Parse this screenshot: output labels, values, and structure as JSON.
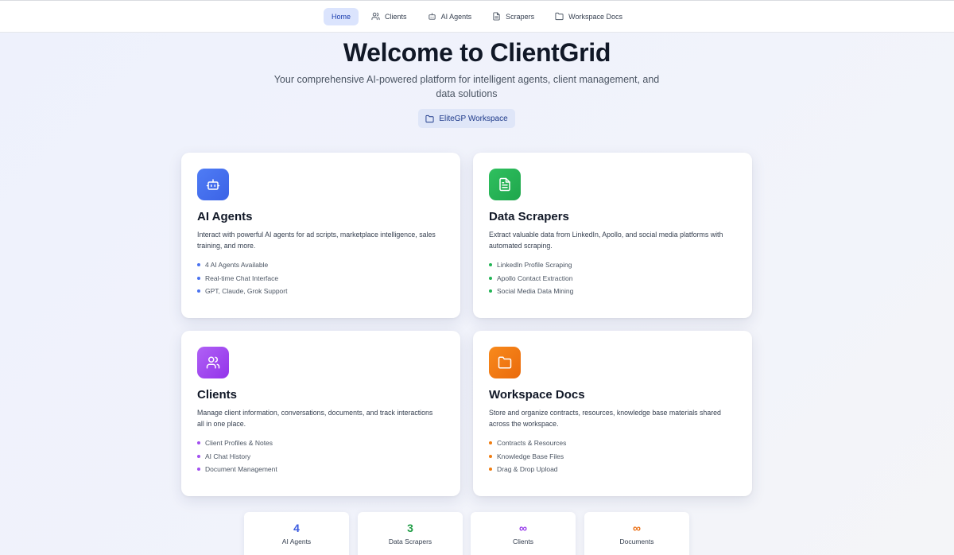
{
  "nav": {
    "items": [
      {
        "label": "Home",
        "icon": "home"
      },
      {
        "label": "Clients",
        "icon": "users-icon"
      },
      {
        "label": "AI Agents",
        "icon": "bot-icon"
      },
      {
        "label": "Scrapers",
        "icon": "file-text-icon"
      },
      {
        "label": "Workspace Docs",
        "icon": "folder-icon"
      }
    ]
  },
  "hero": {
    "title": "Welcome to ClientGrid",
    "subtitle": "Your comprehensive AI-powered platform for intelligent agents, client management, and data solutions",
    "workspace_label": "EliteGP Workspace"
  },
  "cards": [
    {
      "title": "AI Agents",
      "icon": "bot-icon",
      "color": "#4a72f0",
      "description": "Interact with powerful AI agents for ad scripts, marketplace intelligence, sales training, and more.",
      "features": [
        "4 AI Agents Available",
        "Real-time Chat Interface",
        "GPT, Claude, Grok Support"
      ]
    },
    {
      "title": "Data Scrapers",
      "icon": "file-text-icon",
      "color": "#22b455",
      "description": "Extract valuable data from LinkedIn, Apollo, and social media platforms with automated scraping.",
      "features": [
        "LinkedIn Profile Scraping",
        "Apollo Contact Extraction",
        "Social Media Data Mining"
      ]
    },
    {
      "title": "Clients",
      "icon": "users-icon",
      "color": "#a24ff0",
      "description": "Manage client information, conversations, documents, and track interactions all in one place.",
      "features": [
        "Client Profiles & Notes",
        "AI Chat History",
        "Document Management"
      ]
    },
    {
      "title": "Workspace Docs",
      "icon": "folder-icon",
      "color": "#f07c10",
      "description": "Store and organize contracts, resources, knowledge base materials shared across the workspace.",
      "features": [
        "Contracts & Resources",
        "Knowledge Base Files",
        "Drag & Drop Upload"
      ]
    }
  ],
  "stats": [
    {
      "value": "4",
      "label": "AI Agents",
      "color": "#3b5be0"
    },
    {
      "value": "3",
      "label": "Data Scrapers",
      "color": "#1f9d45"
    },
    {
      "value": "∞",
      "label": "Clients",
      "color": "#9333ea"
    },
    {
      "value": "∞",
      "label": "Documents",
      "color": "#ea6a0c"
    }
  ]
}
